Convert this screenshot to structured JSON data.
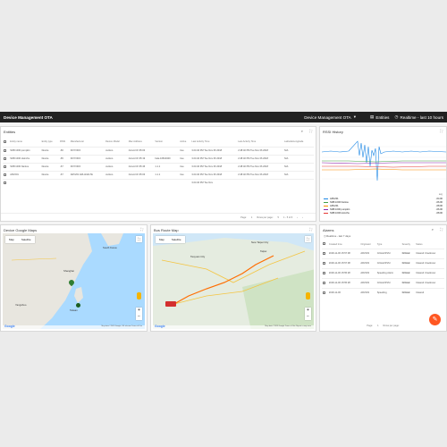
{
  "topbar": {
    "title": "Device Management OTA",
    "dashboard": "Device Management OTA",
    "entities": "Entities",
    "realtime": "Realtime - last 10 hours"
  },
  "entities": {
    "title": "Entities",
    "headers": [
      "Entity name",
      "Entity type",
      "RSSI",
      "Manufacturer",
      "Device Model",
      "Mac Address",
      "Version",
      "Active",
      "Last Activity Time",
      "Last Activity Time",
      "Latitude/Longitude"
    ],
    "rows": [
      [
        "SDB 1000 pumpkin",
        "Device",
        "-66",
        "DOYODO",
        "cuckoo",
        "A4:eA:CF:35:03",
        "",
        "true",
        "3:24:40 PM Tue Nov 06 2018",
        "2:48:40 PM Tue Nov 06 2018",
        "N/A"
      ],
      [
        "SDB 1000 Hsinchu",
        "Device",
        "-65",
        "DOYODO",
        "cuckoo",
        "A4:eA:CF:35:19",
        "bala 10841900",
        "true",
        "3:24:40 PM Tue Nov 06 2018",
        "2:48:40 PM Tue Nov 06 2018",
        "N/A"
      ],
      [
        "SDB 1000 Nantou",
        "Device",
        "-67",
        "DOYODO",
        "cuckoo",
        "A4:eA:CF:35:46",
        "1.1.1",
        "true",
        "3:24:40 PM Tue Nov 06 2018",
        "2:48:40 PM Tue Nov 06 2018",
        "N/A"
      ],
      [
        "ARV201",
        "Device",
        "-67",
        "ARV201 ARLANALTE",
        "cuckoo",
        "A4:eA:CF:35:03",
        "1.1.1",
        "true",
        "3:24:40 PM Tue Nov 06 2018",
        "2:48:40 PM Tue Nov 06 2018",
        "N/A"
      ],
      [
        "",
        "",
        "",
        "",
        "",
        "",
        "",
        "",
        "3:24:40 PM Tue Nov",
        "",
        ""
      ]
    ],
    "pager": {
      "page_label": "Page:",
      "page": "1",
      "rows_label": "Rows per page:",
      "rows": "5",
      "range": "1 - 5 of 6"
    }
  },
  "rssi": {
    "title": "RSSI History",
    "legend": [
      {
        "name": "ARV201",
        "color": "#1e88e5",
        "value": "-64.00"
      },
      {
        "name": "SDB 1000 Nantou",
        "color": "#43a047",
        "value": "-66.00"
      },
      {
        "name": "ARV201",
        "color": "#fb8c00",
        "value": "-68.00"
      },
      {
        "name": "SDB 1000 pumpkin",
        "color": "#8e24aa",
        "value": "-66.00"
      },
      {
        "name": "SDB 1000 Hsinchu",
        "color": "#e53935",
        "value": "-68.00"
      }
    ],
    "legend_headers": [
      "",
      "avg"
    ],
    "ticks": [
      "14:00",
      "15:00",
      "16:00",
      "17:00",
      "18:00",
      "19:00",
      "20:00",
      "21:00",
      "22:00",
      "23:00"
    ]
  },
  "maps": {
    "google": {
      "title": "Device Google Maps",
      "tab_map": "Map",
      "tab_sat": "Satellite",
      "attribution": "Map data ©2018 Google, SK telecom  Terms of Use",
      "logo": "Google",
      "labels": [
        "South Korea",
        "Shanghai",
        "Taiwan",
        "Yangshuo"
      ]
    },
    "bus": {
      "title": "Bus Route Map",
      "tab_map": "Map",
      "tab_sat": "Satellite",
      "attribution": "Map data ©2018 Google  Terms of Use  Report a map error",
      "logo": "Google",
      "labels": [
        "Taoyuan City",
        "New Taipei City",
        "Taipei"
      ]
    }
  },
  "alarms": {
    "title": "Alarms",
    "subtitle": "Realtime - last 7 days",
    "headers": [
      "Created time",
      "Originator",
      "Type",
      "Severity",
      "Status"
    ],
    "rows": [
      [
        "2018-11-06 15:57:08",
        "ARV203",
        "Critical RSSI",
        "Critical",
        "Cleared Unacknow"
      ],
      [
        "2018-11-06 15:57:08",
        "ARV203",
        "Critical RSSI",
        "Critical",
        "Cleared Unacknow"
      ],
      [
        "2018-11-06 15:55:28",
        "ARV203",
        "Speeding Alarm",
        "Critical",
        "Cleared Unacknow"
      ],
      [
        "2018-11-06 15:55:28",
        "ARV203",
        "Critical RSSI",
        "Critical",
        "Cleared Unacknow"
      ],
      [
        "2018-11-06",
        "ARV203",
        "Speeding",
        "Critical",
        "Cleared"
      ]
    ],
    "pager": {
      "page_label": "Page:",
      "page": "1",
      "rows_label": "Rows per page:"
    }
  }
}
